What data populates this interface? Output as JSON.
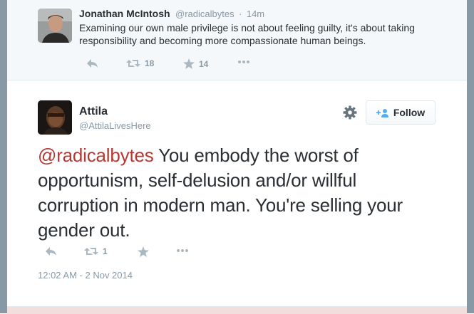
{
  "parent": {
    "name": "Jonathan McIntosh",
    "handle": "@radicalbytes",
    "separator": "·",
    "time": "14m",
    "text": "Examining our own male privilege is not about feeling guilty, it's about taking responsibility and becoming more compassionate human beings.",
    "retweets": "18",
    "favorites": "14"
  },
  "main": {
    "name": "Attila",
    "handle": "@AttilaLivesHere",
    "follow_label": "Follow",
    "mention": "@radicalbytes",
    "text": " You embody the worst of opportunism, self-delusion and/or willful corruption in modern man. You're selling your gender out.",
    "retweets": "1",
    "timestamp": "12:02 AM - 2 Nov 2014"
  },
  "icons": {
    "reply": "reply-icon",
    "retweet": "retweet-icon",
    "favorite": "star-icon",
    "more": "more-icon",
    "settings": "gear-icon",
    "follow": "add-user-icon"
  },
  "colors": {
    "mention": "#b53932",
    "meta_text": "#8899a6",
    "icon": "#aab8c2",
    "parent_bg": "#f5f8fa"
  }
}
